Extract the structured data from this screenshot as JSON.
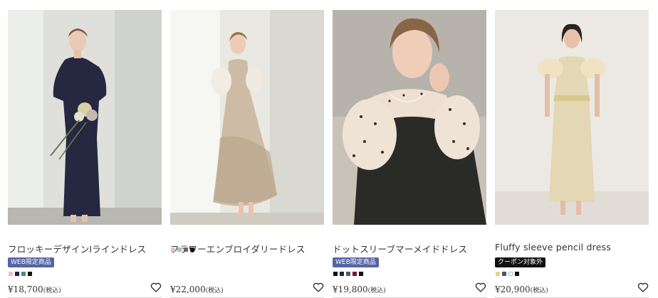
{
  "products": [
    {
      "name": "フロッキーデザインIラインドレス",
      "badge": "WEB限定商品",
      "badge_color": "#5563a7",
      "swatches": [
        "#e8c4c0",
        "#1c2547",
        "#4d8b75",
        "#111111"
      ],
      "price": "¥18,700",
      "tax": "(税込)",
      "image": "woman-navy-dress-bouquet-photo"
    },
    {
      "name": "フラワーエンブロイダリードレス",
      "badge": "",
      "badge_color": "",
      "swatches": [
        "#e6c6c3",
        "#a9c4bb",
        "#8a5a5c",
        "#111111"
      ],
      "price": "¥22,000",
      "tax": "(税込)",
      "image": "woman-floral-tulle-dress-photo"
    },
    {
      "name": "ドットスリーブマーメイドドレス",
      "badge": "WEB限定商品",
      "badge_color": "#5563a7",
      "swatches": [
        "#111111",
        "#1c2547",
        "#5a5a5a",
        "#7a1424",
        "#111111"
      ],
      "price": "¥19,800",
      "tax": "(税込)",
      "image": "woman-dot-sleeve-dress-photo"
    },
    {
      "name": "Fluffy sleeve pencil dress",
      "badge": "クーポン対象外",
      "badge_color": "#111111",
      "swatches": [
        "#e8d58c",
        "#555555",
        "#ffffff",
        "#111111"
      ],
      "price": "¥20,900",
      "tax": "(税込)",
      "image": "woman-gold-lace-pencil-dress-photo"
    }
  ],
  "icons": {
    "favorite": "heart-outline-icon"
  }
}
